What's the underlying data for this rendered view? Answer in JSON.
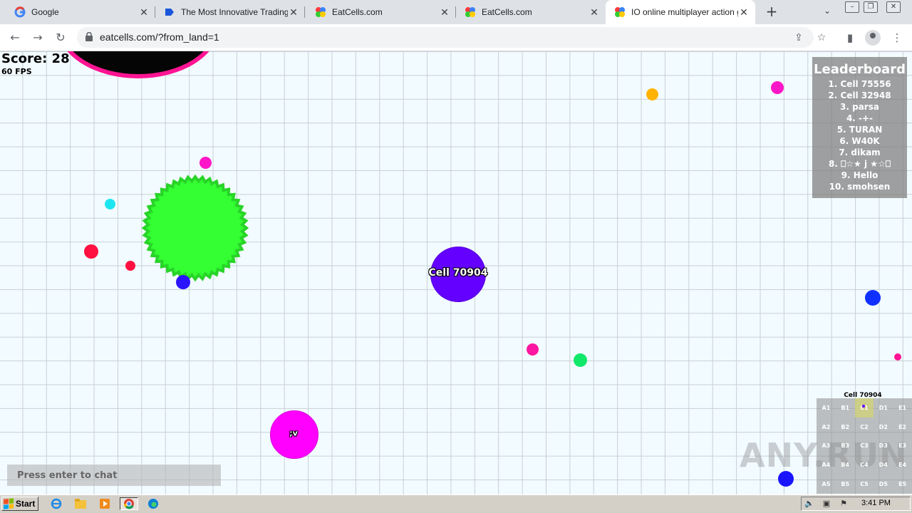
{
  "tabs": [
    {
      "title": "Google",
      "icon": "google-icon"
    },
    {
      "title": "The Most Innovative Trading Pl",
      "icon": "trading-site-icon"
    },
    {
      "title": "EatCells.com",
      "icon": "eatcells-icon"
    },
    {
      "title": "EatCells.com",
      "icon": "eatcells-icon"
    },
    {
      "title": "IO online multiplayer action ga",
      "icon": "eatcells-icon"
    }
  ],
  "toolbar": {
    "url": "eatcells.com/?from_land=1"
  },
  "game": {
    "score": "Score: 28",
    "fps": "60 FPS",
    "leaderboard_title": "Leaderboard",
    "leaderboard": [
      "1. Cell 75556",
      "2. Cell 32948",
      "3. parsa",
      "4. -+-",
      "5. TURAN",
      "6. W40K",
      "7. dikam",
      "8. ⎕☆★ j ★☆⎕",
      "9. Hello",
      "10. smohsen"
    ],
    "player_cell_name": "Cell 70904",
    "enemy_cell_name": ";v",
    "chat_placeholder": "Press enter to chat",
    "minimap_title": "Cell 70904",
    "minimap_cells": [
      "A1",
      "B1",
      "C1",
      "D1",
      "E1",
      "A2",
      "B2",
      "C2",
      "D2",
      "E2",
      "A3",
      "B3",
      "C3",
      "D3",
      "E3",
      "A4",
      "B4",
      "C4",
      "D4",
      "E4",
      "A5",
      "B5",
      "C5",
      "D5",
      "E5"
    ],
    "minimap_active": "C1",
    "watermark": "ANY.RUN",
    "colors": {
      "player": "#6400ff",
      "virus": "#33ff33",
      "enemy": "#ff00ff",
      "top_cell_border": "#ff1493"
    }
  },
  "taskbar": {
    "start_label": "Start",
    "clock": "3:41 PM"
  }
}
